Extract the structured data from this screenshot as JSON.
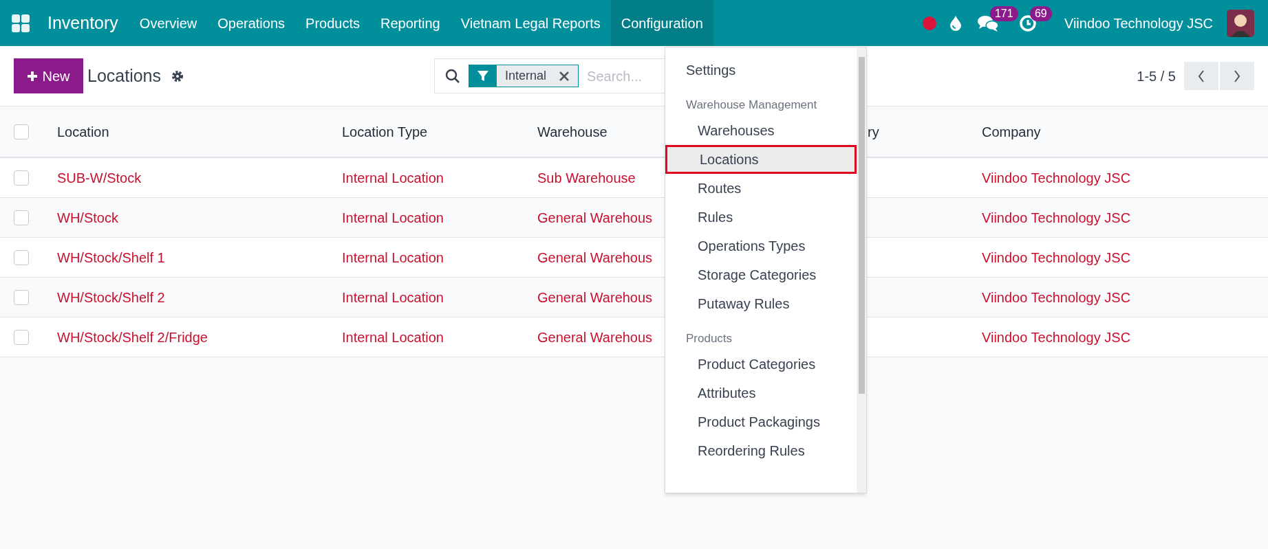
{
  "navbar": {
    "app": "Inventory",
    "menus": [
      {
        "label": "Overview",
        "selected": false
      },
      {
        "label": "Operations",
        "selected": false
      },
      {
        "label": "Products",
        "selected": false
      },
      {
        "label": "Reporting",
        "selected": false
      },
      {
        "label": "Vietnam Legal Reports",
        "selected": false
      },
      {
        "label": "Configuration",
        "selected": true
      }
    ],
    "messages_count": "171",
    "activities_count": "69",
    "company": "Viindoo Technology JSC"
  },
  "control_panel": {
    "new_button": "New",
    "title": "Locations",
    "facets": [
      {
        "label": "Internal"
      }
    ],
    "search_placeholder": "Search...",
    "pager": "1-5 / 5"
  },
  "table": {
    "all_selected": false,
    "columns": [
      "Location",
      "Location Type",
      "Warehouse",
      "ry",
      "Company"
    ],
    "rows": [
      {
        "selected": false,
        "cells": [
          "SUB-W/Stock",
          "Internal Location",
          "Sub Warehouse",
          "",
          "Viindoo Technology JSC"
        ]
      },
      {
        "selected": false,
        "cells": [
          "WH/Stock",
          "Internal Location",
          "General Warehous",
          "",
          "Viindoo Technology JSC"
        ]
      },
      {
        "selected": false,
        "cells": [
          "WH/Stock/Shelf 1",
          "Internal Location",
          "General Warehous",
          "",
          "Viindoo Technology JSC"
        ]
      },
      {
        "selected": false,
        "cells": [
          "WH/Stock/Shelf 2",
          "Internal Location",
          "General Warehous",
          "",
          "Viindoo Technology JSC"
        ]
      },
      {
        "selected": false,
        "cells": [
          "WH/Stock/Shelf 2/Fridge",
          "Internal Location",
          "General Warehous",
          "",
          "Viindoo Technology JSC"
        ]
      }
    ]
  },
  "dropdown": {
    "items": [
      {
        "kind": "item",
        "label": "Settings",
        "selected": false,
        "indented": false
      },
      {
        "kind": "header",
        "label": "Warehouse Management"
      },
      {
        "kind": "item",
        "label": "Warehouses",
        "selected": false,
        "indented": true
      },
      {
        "kind": "item",
        "label": "Locations",
        "selected": true,
        "indented": true
      },
      {
        "kind": "item",
        "label": "Routes",
        "selected": false,
        "indented": true
      },
      {
        "kind": "item",
        "label": "Rules",
        "selected": false,
        "indented": true
      },
      {
        "kind": "item",
        "label": "Operations Types",
        "selected": false,
        "indented": true
      },
      {
        "kind": "item",
        "label": "Storage Categories",
        "selected": false,
        "indented": true
      },
      {
        "kind": "item",
        "label": "Putaway Rules",
        "selected": false,
        "indented": true
      },
      {
        "kind": "header",
        "label": "Products"
      },
      {
        "kind": "item",
        "label": "Product Categories",
        "selected": false,
        "indented": true
      },
      {
        "kind": "item",
        "label": "Attributes",
        "selected": false,
        "indented": true
      },
      {
        "kind": "item",
        "label": "Product Packagings",
        "selected": false,
        "indented": true
      },
      {
        "kind": "item",
        "label": "Reordering Rules",
        "selected": false,
        "indented": true
      }
    ]
  }
}
